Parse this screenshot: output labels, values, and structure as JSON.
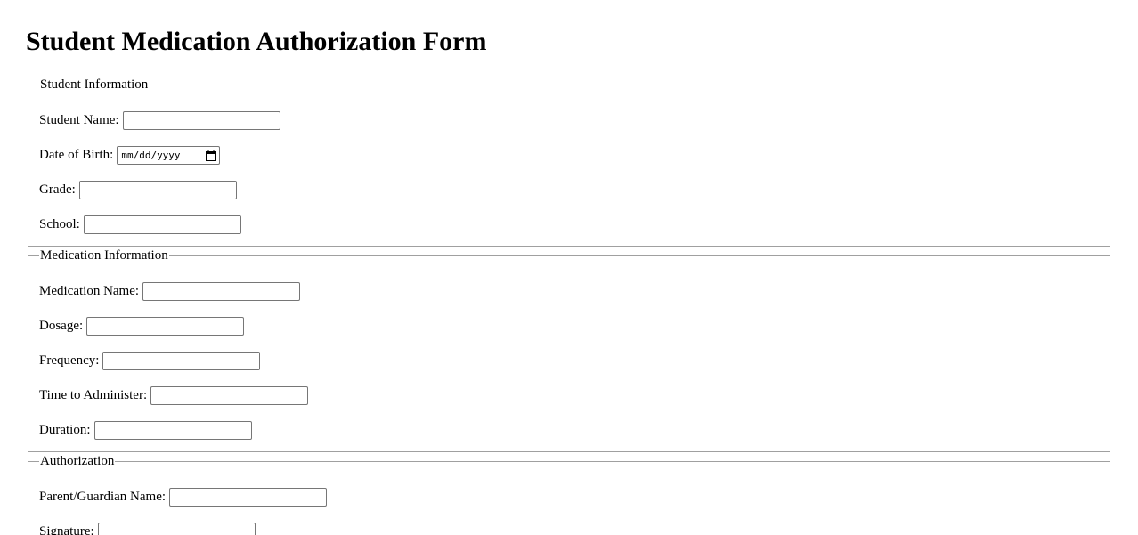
{
  "page": {
    "title": "Student Medication Authorization Form"
  },
  "student_info": {
    "legend": "Student Information",
    "student_name_label": "Student Name:",
    "student_name_value": "",
    "dob_label": "Date of Birth:",
    "dob_placeholder": "mm/dd/yyyy",
    "grade_label": "Grade:",
    "grade_value": "",
    "school_label": "School:",
    "school_value": ""
  },
  "medication_info": {
    "legend": "Medication Information",
    "medication_name_label": "Medication Name:",
    "medication_name_value": "",
    "dosage_label": "Dosage:",
    "dosage_value": "",
    "frequency_label": "Frequency:",
    "frequency_value": "",
    "time_label": "Time to Administer:",
    "time_value": "",
    "duration_label": "Duration:",
    "duration_value": ""
  },
  "authorization": {
    "legend": "Authorization",
    "guardian_name_label": "Parent/Guardian Name:",
    "guardian_name_value": "",
    "signature_label": "Signature:",
    "signature_value": ""
  },
  "icons": {
    "date_picker": "calendar-icon"
  }
}
